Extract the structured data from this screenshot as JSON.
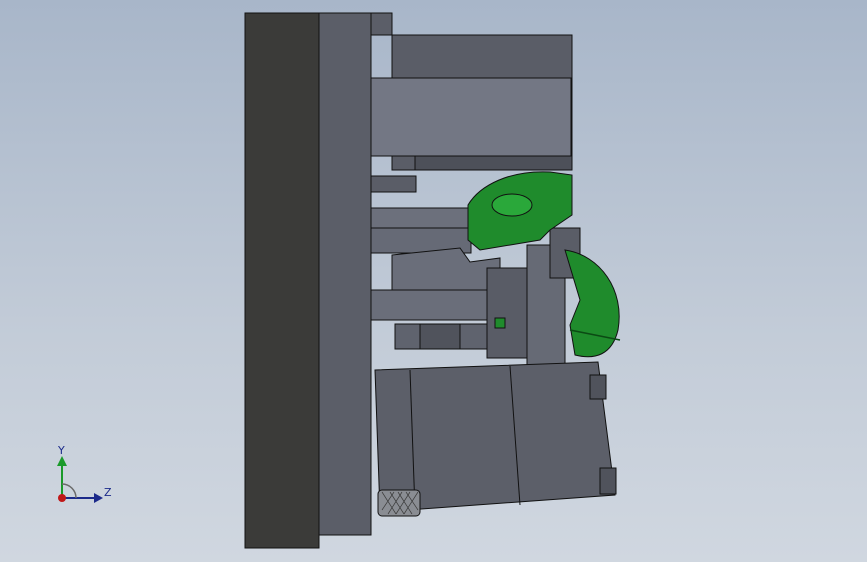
{
  "viewport": {
    "background_top": "#a8b6c9",
    "background_bottom": "#d0d7e0"
  },
  "model": {
    "description_icon": "cad-assembly-icon",
    "colors": {
      "dark_plate": "#3a3a38",
      "body_gray": "#5a5d68",
      "light_gray": "#767a87",
      "part_green": "#1e8a2a",
      "green_highlight": "#3cc05a",
      "edge": "#111111"
    }
  },
  "triad": {
    "y_label": "Y",
    "z_label": "Z",
    "y_color": "#1a9a2a",
    "z_color": "#1b2a8a",
    "origin_color": "#c01818"
  }
}
